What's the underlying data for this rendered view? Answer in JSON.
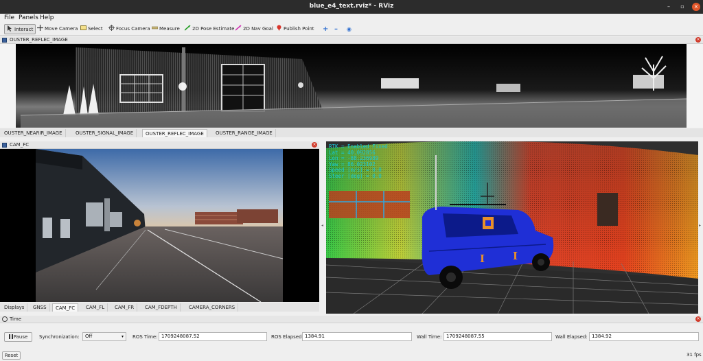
{
  "window": {
    "title": "blue_e4_text.rviz* - RViz",
    "minimize": "–",
    "maximize": "▫",
    "close": "×"
  },
  "menu": [
    "File",
    "Panels",
    "Help"
  ],
  "toolbar": {
    "interact": "Interact",
    "move_camera": "Move Camera",
    "select": "Select",
    "focus_camera": "Focus Camera",
    "measure": "Measure",
    "pose_estimate": "2D Pose Estimate",
    "nav_goal": "2D Nav Goal",
    "publish_point": "Publish Point",
    "plus": "+",
    "minus": "–",
    "target": "◉"
  },
  "ouster_panel": {
    "title": "OUSTER_REFLEC_IMAGE"
  },
  "ouster_tabs": [
    "OUSTER_NEARIR_IMAGE",
    "OUSTER_SIGNAL_IMAGE",
    "OUSTER_REFLEC_IMAGE",
    "OUSTER_RANGE_IMAGE"
  ],
  "cam_panel": {
    "title": "CAM_FC"
  },
  "left_tabs": [
    "Displays",
    "GNSS",
    "CAM_FC",
    "CAM_FL",
    "CAM_FR",
    "CAM_FDEPTH",
    "CAMERA_CORNERS"
  ],
  "hud": {
    "line1": "RTK = Enabled Fixed",
    "line2": "Lat = 40.092856",
    "line3": "Lon = -88.236989",
    "line4": "Yaw = 86.023102",
    "line5": "Speed [m/s] = 0.0",
    "line6": "Steer [deg] = 0.0"
  },
  "car_letter": "I",
  "time_panel": {
    "title": "Time",
    "pause": "Pause",
    "sync_label": "Synchronization:",
    "sync_value": "Off",
    "ros_time_label": "ROS Time:",
    "ros_time": "1709248087.52",
    "ros_elapsed_label": "ROS Elapsed:",
    "ros_elapsed": "1384.91",
    "wall_time_label": "Wall Time:",
    "wall_time": "1709248087.55",
    "wall_elapsed_label": "Wall Elapsed:",
    "wall_elapsed": "1384.92"
  },
  "status": {
    "reset": "Reset",
    "fps": "31 fps"
  },
  "colors": {
    "accent_active_tab": "#f7f7f7",
    "close_red": "#d13c2c",
    "titlebar": "#2c2c2c",
    "hud_text": "#19c8d8",
    "car_blue": "#1f2fd6",
    "car_letter": "#e8902a"
  }
}
